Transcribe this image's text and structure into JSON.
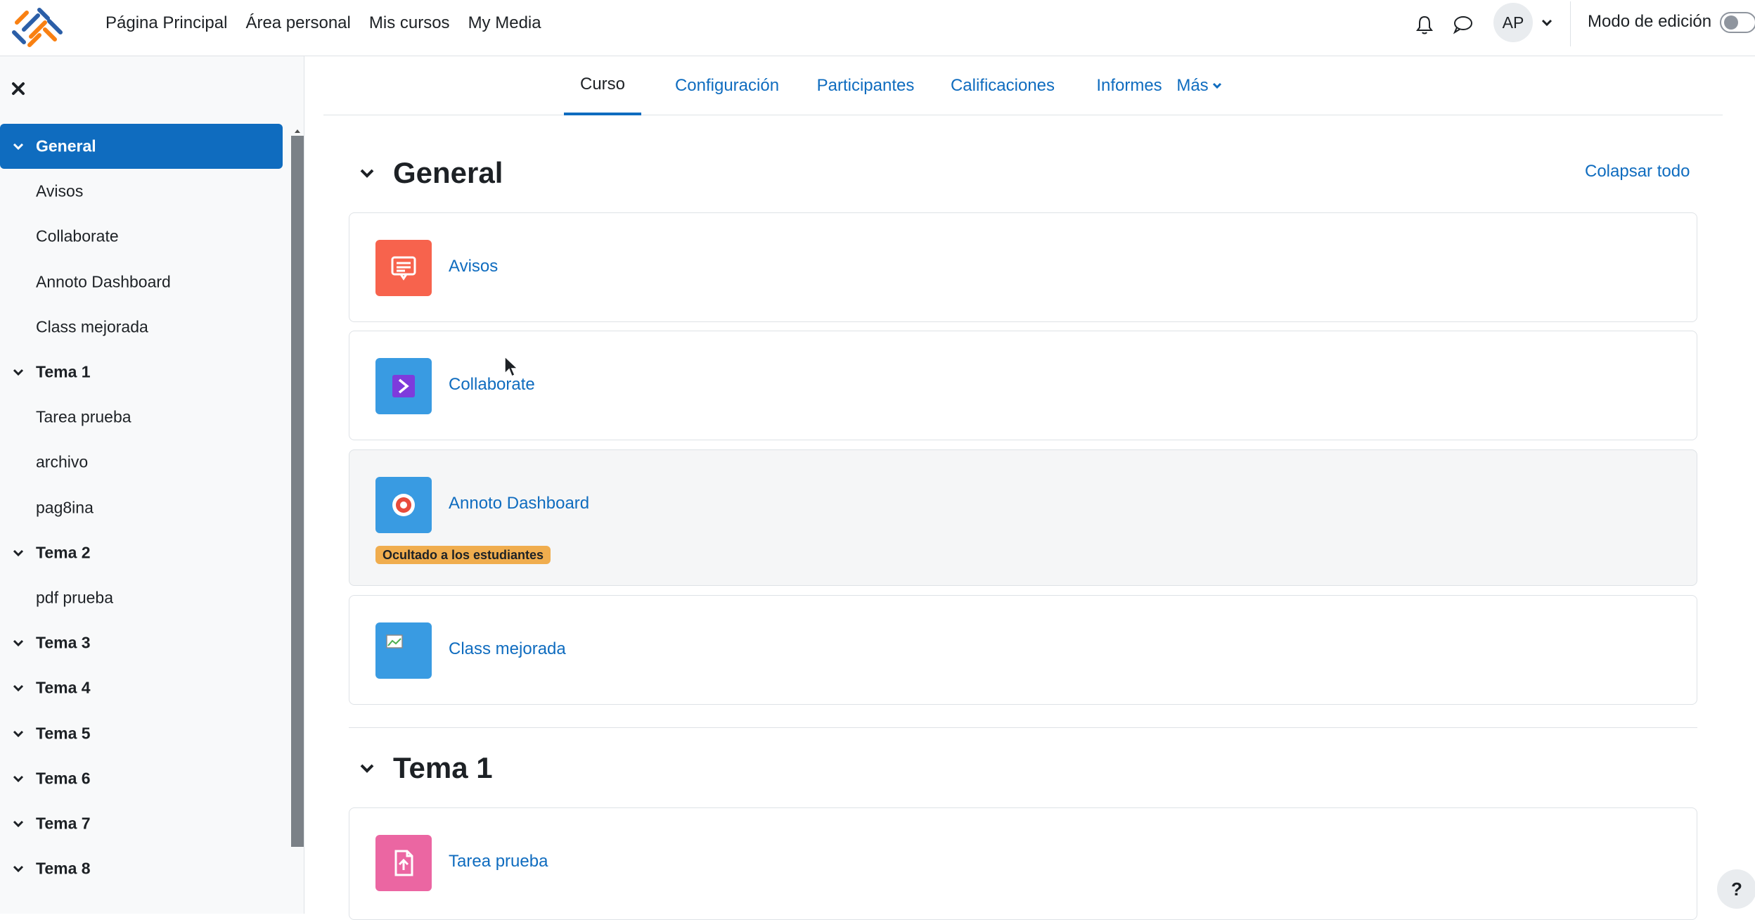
{
  "navbar": {
    "logo_icon": "moodle-logo-icon",
    "links": [
      "Página Principal",
      "Área personal",
      "Mis cursos",
      "My Media"
    ],
    "avatar_initials": "AP",
    "edit_mode_label": "Modo de edición",
    "edit_mode_on": false
  },
  "drawer": {
    "items": [
      {
        "label": "General",
        "type": "section",
        "active": true
      },
      {
        "label": "Avisos",
        "type": "activity"
      },
      {
        "label": "Collaborate",
        "type": "activity"
      },
      {
        "label": "Annoto Dashboard",
        "type": "activity"
      },
      {
        "label": "Class mejorada",
        "type": "activity"
      },
      {
        "label": "Tema 1",
        "type": "section"
      },
      {
        "label": "Tarea prueba",
        "type": "activity"
      },
      {
        "label": "archivo",
        "type": "activity"
      },
      {
        "label": "pag8ina",
        "type": "activity"
      },
      {
        "label": "Tema 2",
        "type": "section"
      },
      {
        "label": "pdf prueba",
        "type": "activity"
      },
      {
        "label": "Tema 3",
        "type": "section"
      },
      {
        "label": "Tema 4",
        "type": "section"
      },
      {
        "label": "Tema 5",
        "type": "section"
      },
      {
        "label": "Tema 6",
        "type": "section"
      },
      {
        "label": "Tema 7",
        "type": "section"
      },
      {
        "label": "Tema 8",
        "type": "section"
      }
    ]
  },
  "tabs": [
    {
      "label": "Curso",
      "active": true
    },
    {
      "label": "Configuración"
    },
    {
      "label": "Participantes"
    },
    {
      "label": "Calificaciones"
    },
    {
      "label": "Informes"
    },
    {
      "label": "Más"
    }
  ],
  "main": {
    "collapse_all": "Colapsar todo",
    "sections": [
      {
        "title": "General",
        "activities": [
          {
            "name": "Avisos",
            "icon": "forum-icon",
            "color": "#f7634d"
          },
          {
            "name": "Collaborate",
            "icon": "collaborate-icon",
            "color": "#399be2"
          },
          {
            "name": "Annoto Dashboard",
            "icon": "annoto-icon",
            "color": "#399be2",
            "badge": "Ocultado a los estudiantes"
          },
          {
            "name": "Class mejorada",
            "icon": "broken-image-icon",
            "color": "#399be2"
          }
        ]
      },
      {
        "title": "Tema 1",
        "activities": [
          {
            "name": "Tarea prueba",
            "icon": "assignment-icon",
            "color": "#eb66a2"
          }
        ]
      }
    ]
  },
  "help_label": "?"
}
